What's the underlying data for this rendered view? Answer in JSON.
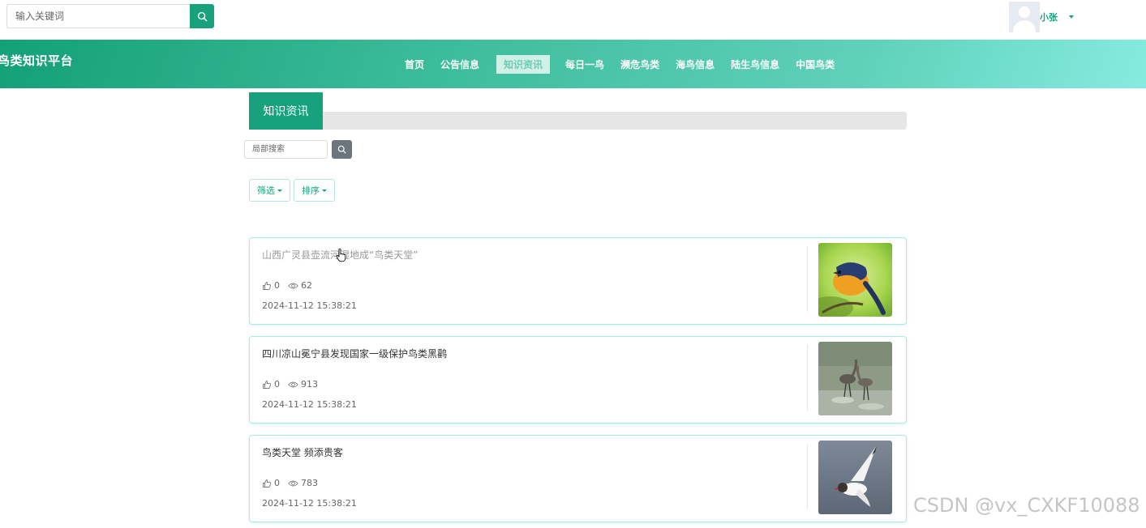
{
  "top_search": {
    "placeholder": "输入关键词"
  },
  "user": {
    "name": "小张"
  },
  "site": {
    "title": "鸟类知识平台"
  },
  "nav": {
    "items": [
      {
        "label": "首页",
        "active": false
      },
      {
        "label": "公告信息",
        "active": false
      },
      {
        "label": "知识资讯",
        "active": true
      },
      {
        "label": "每日一鸟",
        "active": false
      },
      {
        "label": "濒危鸟类",
        "active": false
      },
      {
        "label": "海鸟信息",
        "active": false
      },
      {
        "label": "陆生鸟信息",
        "active": false
      },
      {
        "label": "中国鸟类",
        "active": false
      }
    ]
  },
  "section": {
    "title": "知识资讯"
  },
  "local_search": {
    "placeholder": "局部搜索"
  },
  "filters": {
    "filter_label": "筛选",
    "sort_label": "排序"
  },
  "articles": [
    {
      "title": "山西广灵县壶流河湿地成“鸟类天堂”",
      "likes": "0",
      "views": "62",
      "date": "2024-11-12 15:38:21",
      "image": "orange-songbird"
    },
    {
      "title": "四川凉山冕宁县发现国家一级保护鸟类黑鹳",
      "likes": "0",
      "views": "913",
      "date": "2024-11-12 15:38:21",
      "image": "wading-birds"
    },
    {
      "title": "鸟类天堂 频添贵客",
      "likes": "0",
      "views": "783",
      "date": "2024-11-12 15:38:21",
      "image": "flying-gull"
    }
  ],
  "watermark": "CSDN @vx_CXKF10088",
  "colors": {
    "primary": "#17a27d",
    "card_border": "#a9ece4",
    "nav_gradient_end": "#86ebe0"
  }
}
